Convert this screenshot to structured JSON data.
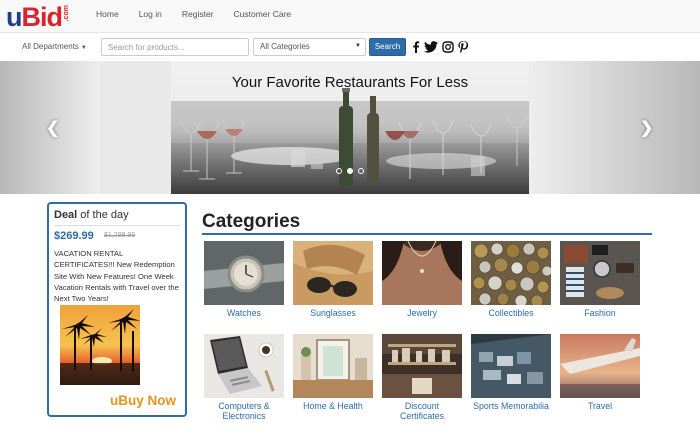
{
  "brand": {
    "u": "u",
    "bid": "Bid",
    "com": ".com"
  },
  "nav": {
    "items": [
      "Home",
      "Log in",
      "Register",
      "Customer Care"
    ]
  },
  "search": {
    "departments_label": "All Departments",
    "placeholder": "Search for products...",
    "category_value": "All Categories",
    "button_label": "Search"
  },
  "social": {
    "icons": [
      "facebook-icon",
      "twitter-icon",
      "instagram-icon",
      "pinterest-icon"
    ]
  },
  "hero": {
    "title": "Your Favorite Restaurants For Less",
    "slide_count": 3,
    "active_slide": 2
  },
  "deal": {
    "heading_bold": "Deal",
    "heading_rest": " of the day",
    "price": "$269.99",
    "old_price": "$1,299.99",
    "description": "VACATION RENTAL CERTIFICATES!!! New Redemption Site With New Features! One Week Vacation Rentals with Travel over the Next Two Years!",
    "buy_label": "uBuy Now"
  },
  "categories": {
    "title": "Categories",
    "items": [
      {
        "label": "Watches"
      },
      {
        "label": "Sunglasses"
      },
      {
        "label": "Jewelry"
      },
      {
        "label": "Collectibles"
      },
      {
        "label": "Fashion"
      },
      {
        "label": "Computers & Electronics"
      },
      {
        "label": "Home & Health"
      },
      {
        "label": "Discount Certificates"
      },
      {
        "label": "Sports Memorabilia"
      },
      {
        "label": "Travel"
      }
    ]
  },
  "colors": {
    "brand_blue": "#1f3e8e",
    "brand_red": "#d9232d",
    "link_blue": "#2d6ca8",
    "accent_orange": "#e8931a"
  }
}
